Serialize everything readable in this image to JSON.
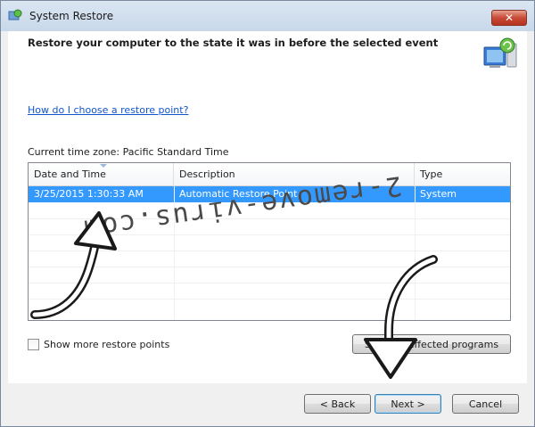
{
  "window": {
    "title": "System Restore",
    "close_glyph": "✕"
  },
  "header": {
    "heading": "Restore your computer to the state it was in before the selected event",
    "icon": "system-restore-icon"
  },
  "body": {
    "help_link": "How do I choose a restore point?",
    "timezone": "Current time zone: Pacific Standard Time",
    "table": {
      "columns": [
        "Date and Time",
        "Description",
        "Type"
      ],
      "rows": [
        {
          "date": "3/25/2015 1:30:33 AM",
          "description": "Automatic Restore Point",
          "type": "System",
          "selected": true
        }
      ]
    },
    "show_more_label": "Show more restore points",
    "scan_button_label": "Scan for affected programs"
  },
  "footer": {
    "back_label": "< Back",
    "next_label": "Next >",
    "cancel_label": "Cancel"
  },
  "watermark": "2-remove-virus.com",
  "colors": {
    "selection": "#3399ff",
    "link": "#1155cc"
  }
}
